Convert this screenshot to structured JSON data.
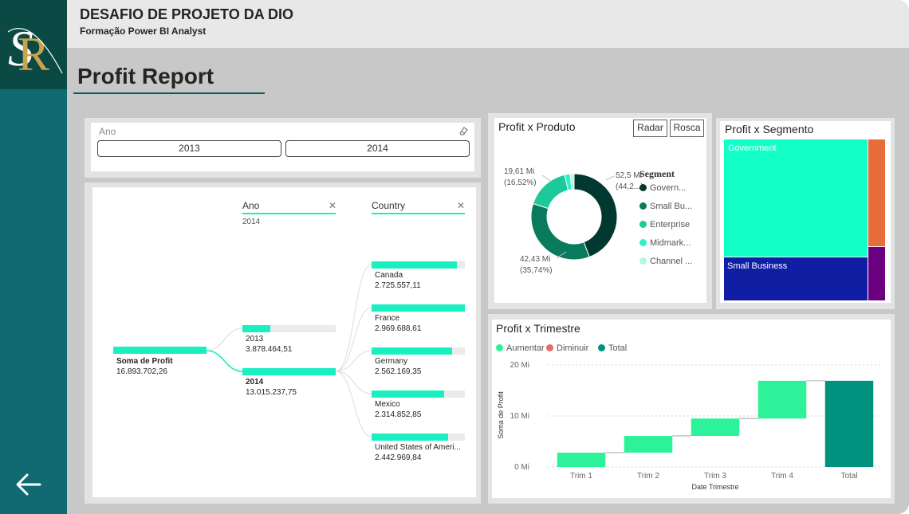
{
  "header": {
    "title": "DESAFIO DE PROJETO DA DIO",
    "subtitle": "Formação Power BI Analyst"
  },
  "page_title": "Profit Report",
  "colors": {
    "logo_bg": "#0b4a44",
    "sidebar": "#0f6a72",
    "accent": "#1aefc2",
    "dark_green": "#01382f",
    "mid_green": "#0a7a5c",
    "light_green": "#1dc99a",
    "aumentar": "#2df29a",
    "diminuir": "#e66c6c",
    "total": "#01927f"
  },
  "slicer": {
    "label": "Ano",
    "options": [
      "2013",
      "2014"
    ]
  },
  "decomposition_tree": {
    "root": {
      "label": "Soma de Profit",
      "value": "16.893.702,26"
    },
    "levels": [
      {
        "header": "Ano",
        "selection": "2014"
      },
      {
        "header": "Country",
        "selection": ""
      }
    ],
    "years": [
      {
        "label": "2013",
        "value": "3.878.464,51",
        "share": 0.298
      },
      {
        "label": "2014",
        "value": "13.015.237,75",
        "share": 1.0
      }
    ],
    "countries": [
      {
        "label": "Canada",
        "value": "2.725.557,11",
        "share": 0.918
      },
      {
        "label": "France",
        "value": "2.969.688,61",
        "share": 1.0
      },
      {
        "label": "Germany",
        "value": "2.562.169,35",
        "share": 0.863
      },
      {
        "label": "Mexico",
        "value": "2.314.852,85",
        "share": 0.78
      },
      {
        "label": "United States of Ameri...",
        "value": "2.442.969,84",
        "share": 0.823
      }
    ]
  },
  "produto": {
    "title": "Profit x Produto",
    "buttons": [
      "Radar",
      "Rosca"
    ],
    "legend_title": "Segment",
    "legend": [
      {
        "label": "Govern...",
        "color": "#01382f"
      },
      {
        "label": "Small Bu...",
        "color": "#0a7a5c"
      },
      {
        "label": "Enterprise",
        "color": "#1dc99a"
      },
      {
        "label": "Midmark...",
        "color": "#2df2c7"
      },
      {
        "label": "Channel ...",
        "color": "#b3f7e6"
      }
    ],
    "labels": [
      {
        "line1": "52,5 Mi",
        "line2": "(44,2...)"
      },
      {
        "line1": "42,43 Mi",
        "line2": "(35,74%)"
      },
      {
        "line1": "19,61 Mi",
        "line2": "(16,52%)"
      }
    ]
  },
  "segmento": {
    "title": "Profit x Segmento",
    "labels": [
      "Government",
      "Small Business"
    ]
  },
  "trimestre": {
    "title": "Profit x Trimestre",
    "legend": [
      {
        "label": "Aumentar",
        "color": "#2df29a"
      },
      {
        "label": "Diminuir",
        "color": "#e66c6c"
      },
      {
        "label": "Total",
        "color": "#01927f"
      }
    ]
  },
  "chart_data": [
    {
      "type": "pie",
      "title": "Profit x Produto",
      "legend_title": "Segment",
      "categories": [
        "Government",
        "Small Business",
        "Enterprise",
        "Midmarket",
        "Channel Partners"
      ],
      "values": [
        52.5,
        42.43,
        19.61,
        2.5,
        1.7
      ],
      "unit": "Mi"
    },
    {
      "type": "treemap",
      "title": "Profit x Segmento",
      "categories": [
        "Government",
        "Small Business",
        "Enterprise",
        "Channel Partners"
      ],
      "values": [
        52.5,
        42.43,
        19.61,
        11.0
      ],
      "colors": [
        "#12ffc8",
        "#0f1ea3",
        "#e66c3a",
        "#6a0080"
      ]
    },
    {
      "type": "bar",
      "subtype": "waterfall",
      "title": "Profit x Trimestre",
      "categories": [
        "Trim 1",
        "Trim 2",
        "Trim 3",
        "Trim 4",
        "Total"
      ],
      "increments": [
        2.8,
        3.3,
        3.4,
        7.4
      ],
      "total": 16.9,
      "xlabel": "Date Trimestre",
      "ylabel": "Soma de Profit",
      "yticks": [
        "0 Mi",
        "10 Mi",
        "20 Mi"
      ],
      "ylim": [
        0,
        20
      ]
    }
  ]
}
